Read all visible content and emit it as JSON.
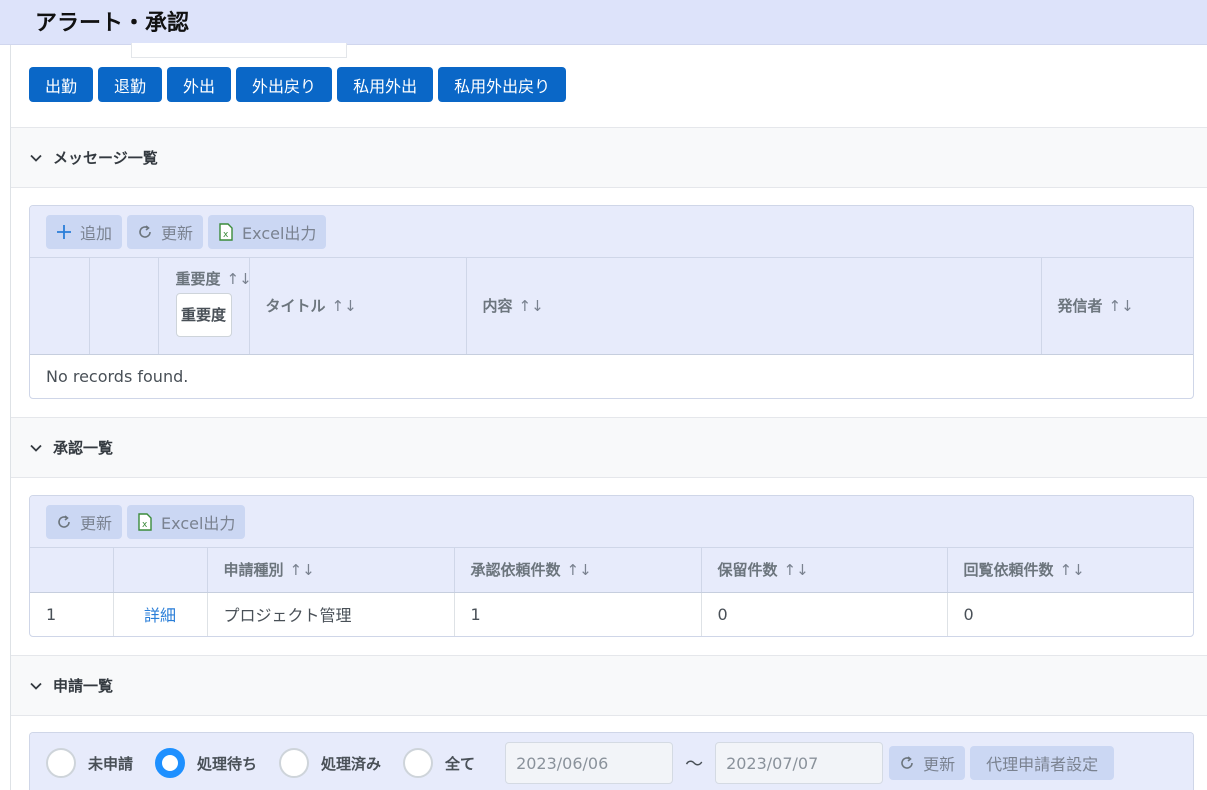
{
  "header": {
    "title": "アラート・承認"
  },
  "punch_buttons": [
    "出勤",
    "退勤",
    "外出",
    "外出戻り",
    "私用外出",
    "私用外出戻り"
  ],
  "messages": {
    "section_title": "メッセージ一覧",
    "toolbar": {
      "add": "追加",
      "refresh": "更新",
      "excel": "Excel出力"
    },
    "columns": {
      "severity": "重要度",
      "title": "タイトル",
      "content": "内容",
      "sender": "発信者"
    },
    "severity_filter_value": "重要度",
    "sort_glyph": "↑↓",
    "empty_text": "No records found."
  },
  "approvals": {
    "section_title": "承認一覧",
    "toolbar": {
      "refresh": "更新",
      "excel": "Excel出力"
    },
    "columns": {
      "type": "申請種別",
      "requests": "承認依頼件数",
      "pending": "保留件数",
      "circulation": "回覧依頼件数"
    },
    "rows": [
      {
        "no": "1",
        "detail": "詳細",
        "type": "プロジェクト管理",
        "requests": "1",
        "pending": "0",
        "circulation": "0"
      }
    ]
  },
  "applications": {
    "section_title": "申請一覧",
    "radios": [
      {
        "label": "未申請",
        "checked": false
      },
      {
        "label": "処理待ち",
        "checked": true
      },
      {
        "label": "処理済み",
        "checked": false
      },
      {
        "label": "全て",
        "checked": false
      }
    ],
    "date_from": "2023/06/06",
    "tilde": "～",
    "date_to": "2023/07/07",
    "refresh": "更新",
    "proxy_settings": "代理申請者設定"
  },
  "colors": {
    "primary": "#0a67c7",
    "header_bg": "#dde3fa",
    "panel_bg": "#e7ebfb",
    "link": "#2a7ed8",
    "radio_on": "#1e90ff"
  }
}
